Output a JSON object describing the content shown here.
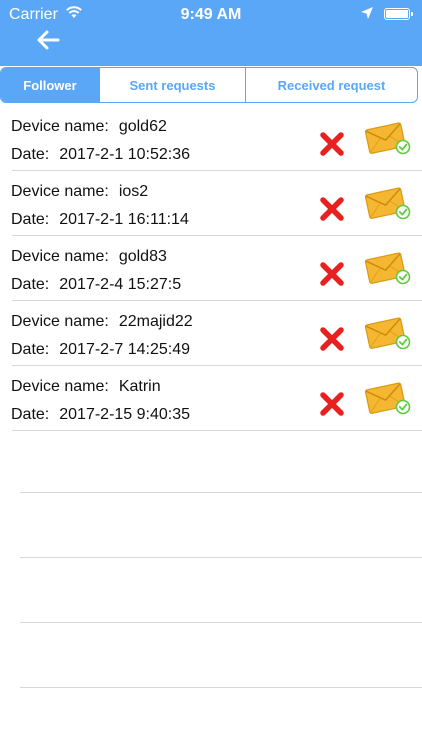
{
  "status_bar": {
    "carrier": "Carrier",
    "time": "9:49 AM"
  },
  "nav": {
    "back_icon": "arrow-left-icon"
  },
  "tabs": [
    {
      "label": "Follower",
      "active": true
    },
    {
      "label": "Sent requests",
      "active": false
    },
    {
      "label": "Received request",
      "active": false
    }
  ],
  "list": {
    "device_label": "Device name:",
    "date_label": "Date:",
    "items": [
      {
        "device": "gold62",
        "date": "2017-2-1 10:52:36"
      },
      {
        "device": "ios2",
        "date": "2017-2-1 16:11:14"
      },
      {
        "device": "gold83",
        "date": "2017-2-4 15:27:5"
      },
      {
        "device": "22majid22",
        "date": "2017-2-7 14:25:49"
      },
      {
        "device": "Katrin",
        "date": "2017-2-15 9:40:35"
      }
    ]
  },
  "colors": {
    "accent": "#5aa7f7",
    "delete": "#e82020",
    "envelope": "#f5b731",
    "check": "#5ccc3c"
  }
}
